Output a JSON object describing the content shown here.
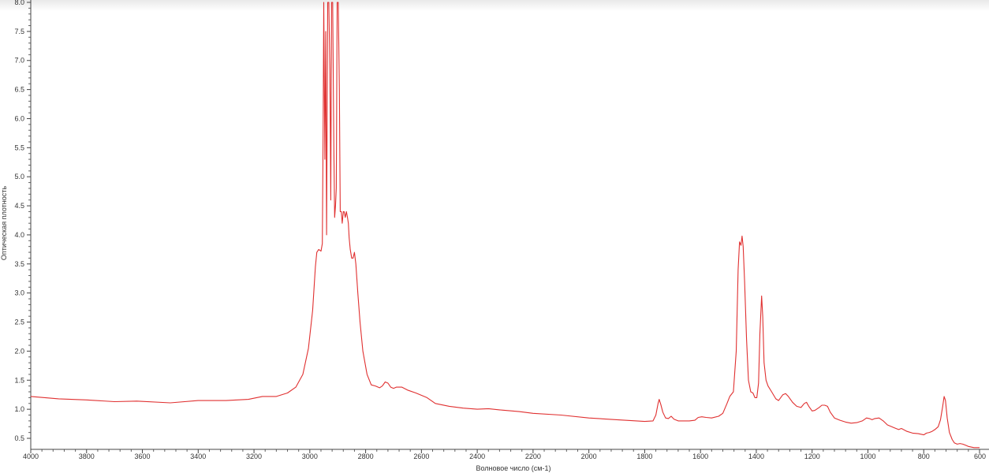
{
  "chart_data": {
    "type": "line",
    "title": "",
    "xlabel": "Волновое число (см-1)",
    "ylabel": "Оптическая плотность",
    "xlim": [
      4000,
      600
    ],
    "ylim": [
      0.3,
      8.0
    ],
    "x_reversed": true,
    "grid": false,
    "line_color": "#e03030",
    "x_ticks": [
      4000,
      3800,
      3600,
      3400,
      3200,
      3000,
      2800,
      2600,
      2400,
      2200,
      2000,
      1800,
      1600,
      1400,
      1200,
      1000,
      800,
      600
    ],
    "y_ticks": [
      "0.5",
      "1.0",
      "1.5",
      "2.0",
      "2.5",
      "3.0",
      "3.5",
      "4.0",
      "4.5",
      "5.0",
      "5.5",
      "6.0",
      "6.5",
      "7.0",
      "7.5",
      "8.0"
    ],
    "series": [
      {
        "points": [
          [
            4000,
            1.22
          ],
          [
            3900,
            1.18
          ],
          [
            3800,
            1.16
          ],
          [
            3700,
            1.13
          ],
          [
            3620,
            1.14
          ],
          [
            3500,
            1.11
          ],
          [
            3400,
            1.15
          ],
          [
            3300,
            1.15
          ],
          [
            3220,
            1.17
          ],
          [
            3170,
            1.22
          ],
          [
            3120,
            1.22
          ],
          [
            3080,
            1.28
          ],
          [
            3050,
            1.38
          ],
          [
            3025,
            1.6
          ],
          [
            3005,
            2.05
          ],
          [
            2990,
            2.7
          ],
          [
            2980,
            3.45
          ],
          [
            2975,
            3.7
          ],
          [
            2968,
            3.75
          ],
          [
            2960,
            3.72
          ],
          [
            2955,
            3.85
          ],
          [
            2952,
            6.0
          ],
          [
            2950,
            8.0
          ],
          [
            2946,
            5.3
          ],
          [
            2943,
            7.5
          ],
          [
            2940,
            4.0
          ],
          [
            2936,
            8.0
          ],
          [
            2932,
            8.0
          ],
          [
            2928,
            6.8
          ],
          [
            2925,
            4.6
          ],
          [
            2922,
            8.0
          ],
          [
            2918,
            8.0
          ],
          [
            2914,
            5.5
          ],
          [
            2911,
            4.3
          ],
          [
            2908,
            4.5
          ],
          [
            2905,
            4.8
          ],
          [
            2902,
            8.0
          ],
          [
            2898,
            8.0
          ],
          [
            2894,
            6.5
          ],
          [
            2891,
            4.4
          ],
          [
            2887,
            4.4
          ],
          [
            2884,
            4.2
          ],
          [
            2880,
            4.4
          ],
          [
            2877,
            4.4
          ],
          [
            2873,
            4.3
          ],
          [
            2869,
            4.4
          ],
          [
            2865,
            4.3
          ],
          [
            2862,
            4.2
          ],
          [
            2859,
            3.95
          ],
          [
            2855,
            3.75
          ],
          [
            2850,
            3.6
          ],
          [
            2845,
            3.6
          ],
          [
            2840,
            3.7
          ],
          [
            2835,
            3.5
          ],
          [
            2828,
            3.0
          ],
          [
            2820,
            2.5
          ],
          [
            2810,
            2.0
          ],
          [
            2795,
            1.6
          ],
          [
            2780,
            1.42
          ],
          [
            2765,
            1.4
          ],
          [
            2750,
            1.37
          ],
          [
            2740,
            1.4
          ],
          [
            2730,
            1.47
          ],
          [
            2720,
            1.45
          ],
          [
            2710,
            1.38
          ],
          [
            2700,
            1.36
          ],
          [
            2690,
            1.38
          ],
          [
            2670,
            1.38
          ],
          [
            2650,
            1.33
          ],
          [
            2620,
            1.28
          ],
          [
            2580,
            1.2
          ],
          [
            2550,
            1.1
          ],
          [
            2500,
            1.05
          ],
          [
            2450,
            1.02
          ],
          [
            2400,
            1.0
          ],
          [
            2360,
            1.01
          ],
          [
            2320,
            0.99
          ],
          [
            2250,
            0.96
          ],
          [
            2200,
            0.93
          ],
          [
            2100,
            0.9
          ],
          [
            2000,
            0.85
          ],
          [
            1900,
            0.82
          ],
          [
            1800,
            0.79
          ],
          [
            1770,
            0.8
          ],
          [
            1760,
            0.9
          ],
          [
            1752,
            1.1
          ],
          [
            1748,
            1.17
          ],
          [
            1742,
            1.08
          ],
          [
            1735,
            0.95
          ],
          [
            1725,
            0.85
          ],
          [
            1715,
            0.84
          ],
          [
            1705,
            0.88
          ],
          [
            1695,
            0.83
          ],
          [
            1680,
            0.8
          ],
          [
            1640,
            0.8
          ],
          [
            1620,
            0.81
          ],
          [
            1608,
            0.86
          ],
          [
            1595,
            0.87
          ],
          [
            1580,
            0.86
          ],
          [
            1560,
            0.85
          ],
          [
            1535,
            0.88
          ],
          [
            1520,
            0.93
          ],
          [
            1505,
            1.1
          ],
          [
            1495,
            1.22
          ],
          [
            1482,
            1.3
          ],
          [
            1472,
            2.0
          ],
          [
            1465,
            3.4
          ],
          [
            1460,
            3.88
          ],
          [
            1455,
            3.82
          ],
          [
            1451,
            3.98
          ],
          [
            1447,
            3.8
          ],
          [
            1442,
            3.2
          ],
          [
            1435,
            2.2
          ],
          [
            1428,
            1.5
          ],
          [
            1420,
            1.3
          ],
          [
            1412,
            1.28
          ],
          [
            1405,
            1.2
          ],
          [
            1398,
            1.2
          ],
          [
            1392,
            1.45
          ],
          [
            1387,
            2.3
          ],
          [
            1381,
            2.95
          ],
          [
            1377,
            2.6
          ],
          [
            1372,
            1.8
          ],
          [
            1365,
            1.5
          ],
          [
            1358,
            1.4
          ],
          [
            1345,
            1.3
          ],
          [
            1330,
            1.18
          ],
          [
            1320,
            1.15
          ],
          [
            1305,
            1.25
          ],
          [
            1295,
            1.27
          ],
          [
            1285,
            1.22
          ],
          [
            1270,
            1.12
          ],
          [
            1255,
            1.05
          ],
          [
            1240,
            1.03
          ],
          [
            1228,
            1.1
          ],
          [
            1220,
            1.12
          ],
          [
            1212,
            1.05
          ],
          [
            1200,
            0.97
          ],
          [
            1190,
            0.98
          ],
          [
            1175,
            1.03
          ],
          [
            1165,
            1.07
          ],
          [
            1155,
            1.07
          ],
          [
            1145,
            1.05
          ],
          [
            1135,
            0.95
          ],
          [
            1120,
            0.85
          ],
          [
            1100,
            0.81
          ],
          [
            1080,
            0.78
          ],
          [
            1060,
            0.76
          ],
          [
            1040,
            0.77
          ],
          [
            1020,
            0.8
          ],
          [
            1005,
            0.85
          ],
          [
            995,
            0.84
          ],
          [
            985,
            0.82
          ],
          [
            975,
            0.84
          ],
          [
            960,
            0.85
          ],
          [
            945,
            0.8
          ],
          [
            930,
            0.73
          ],
          [
            905,
            0.68
          ],
          [
            890,
            0.65
          ],
          [
            880,
            0.67
          ],
          [
            860,
            0.62
          ],
          [
            840,
            0.59
          ],
          [
            820,
            0.58
          ],
          [
            800,
            0.56
          ],
          [
            790,
            0.59
          ],
          [
            780,
            0.6
          ],
          [
            770,
            0.62
          ],
          [
            760,
            0.65
          ],
          [
            748,
            0.7
          ],
          [
            740,
            0.82
          ],
          [
            732,
            1.05
          ],
          [
            727,
            1.22
          ],
          [
            722,
            1.15
          ],
          [
            716,
            0.85
          ],
          [
            708,
            0.6
          ],
          [
            698,
            0.48
          ],
          [
            690,
            0.42
          ],
          [
            680,
            0.4
          ],
          [
            670,
            0.41
          ],
          [
            660,
            0.4
          ],
          [
            650,
            0.38
          ],
          [
            640,
            0.36
          ],
          [
            620,
            0.34
          ],
          [
            600,
            0.34
          ]
        ]
      }
    ]
  }
}
